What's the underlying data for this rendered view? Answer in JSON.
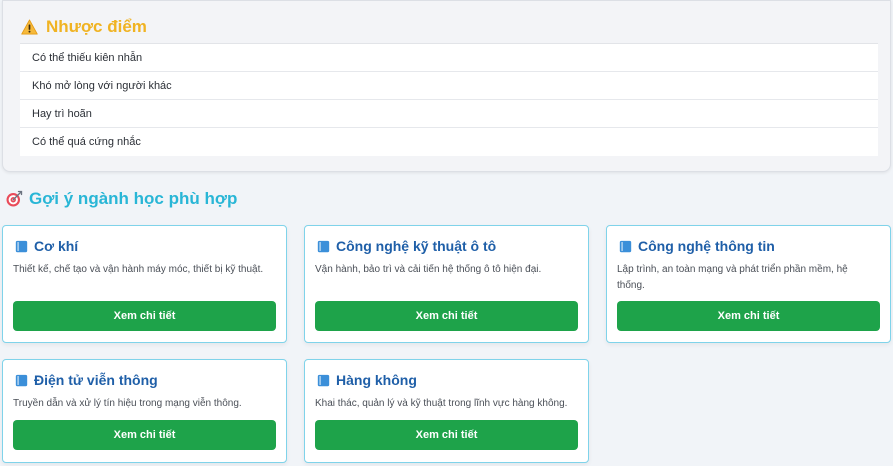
{
  "weaknesses": {
    "title": "Nhược điểm",
    "icon": "warning-icon",
    "items": [
      "Có thể thiếu kiên nhẫn",
      "Khó mở lòng với người khác",
      "Hay trì hoãn",
      "Có thể quá cứng nhắc"
    ]
  },
  "suggestions": {
    "title": "Gợi ý ngành học phù hợp",
    "icon": "target-icon",
    "button_label": "Xem chi tiết",
    "cards": [
      {
        "icon": "book-icon",
        "title": "Cơ khí",
        "desc": "Thiết kế, chế tạo và vận hành máy móc, thiết bị kỹ thuật."
      },
      {
        "icon": "book-icon",
        "title": "Công nghệ kỹ thuật ô tô",
        "desc": "Vận hành, bảo trì và cải tiến hệ thống ô tô hiện đại."
      },
      {
        "icon": "book-icon",
        "title": "Công nghệ thông tin",
        "desc": "Lập trình, an toàn mạng và phát triển phần mềm, hệ thống."
      },
      {
        "icon": "book-icon",
        "title": "Điện tử viễn thông",
        "desc": "Truyền dẫn và xử lý tín hiệu trong mạng viễn thông."
      },
      {
        "icon": "book-icon",
        "title": "Hàng không",
        "desc": "Khai thác, quản lý và kỹ thuật trong lĩnh vực hàng không."
      }
    ]
  },
  "colors": {
    "warning_title": "#f0b323",
    "section_title": "#29b6d6",
    "card_title": "#1f5fa8",
    "card_border": "#7fd3ea",
    "button_bg": "#1ea34a"
  }
}
